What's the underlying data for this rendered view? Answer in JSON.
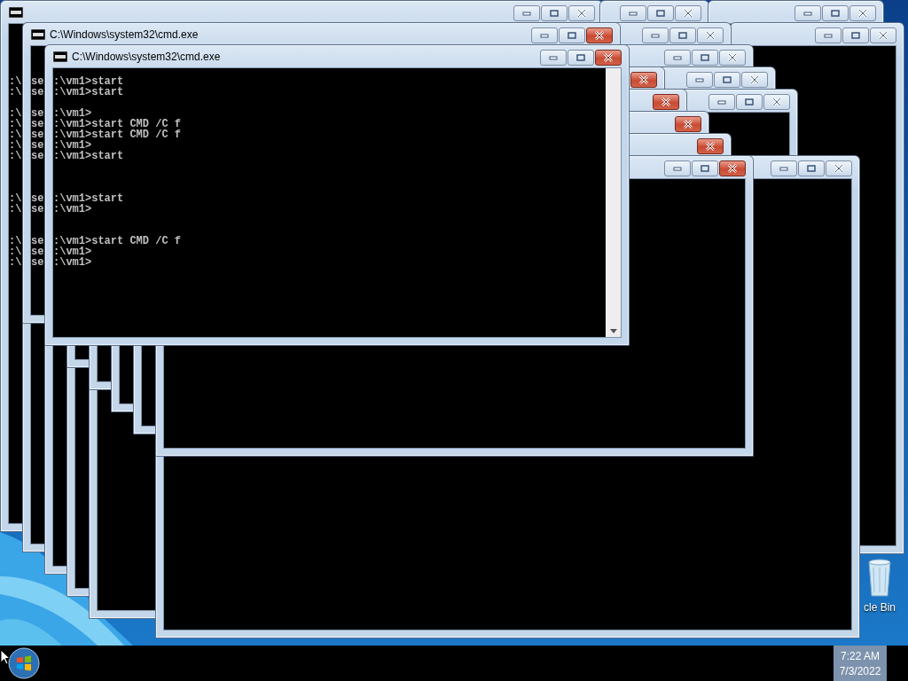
{
  "windows": [
    {
      "close_highlighted": false,
      "icon": true,
      "console_text": ":\\\n:\\\n\n:\\\n:\\\n:\\\n:\\\n:\\\n\n\n\n:\\\n:\\\n\n\n:\\\n:\\\n:\\"
    },
    {
      "close_highlighted": false
    },
    {
      "close_highlighted": false
    },
    {
      "close_highlighted": false
    },
    {
      "close_highlighted": false
    },
    {
      "close_highlighted": false
    },
    {
      "close_highlighted": false
    },
    {
      "close_highlighted": false
    },
    {
      "close_highlighted": false
    },
    {
      "close_highlighted": true
    },
    {
      "close_highlighted": true
    },
    {
      "close_highlighted": true
    },
    {
      "close_highlighted": true
    },
    {
      "close_highlighted": true
    },
    {
      "close_highlighted": true,
      "icon": true,
      "title": "C:\\Windows\\system32\\cmd.exe",
      "console_text": "se\nse\n\nse\nse\nse\nse\nse\n\n\n\nse\nse\n\n\nse\nse\nse"
    },
    {
      "close_highlighted": true,
      "icon": true,
      "title": "C:\\Windows\\system32\\cmd.exe",
      "console_text": ":\\vm1>start\n:\\vm1>start\n\n:\\vm1>\n:\\vm1>start CMD /C f\n:\\vm1>start CMD /C f\n:\\vm1>\n:\\vm1>start\n\n\n\n:\\vm1>start\n:\\vm1>\n\n\n:\\vm1>start CMD /C f\n:\\vm1>\n:\\vm1>",
      "scroll_arrow": true
    }
  ],
  "desktop_icons": [
    {
      "label": "cle Bin"
    }
  ],
  "taskbar": {
    "time": "7:22 AM",
    "date": "7/3/2022"
  }
}
